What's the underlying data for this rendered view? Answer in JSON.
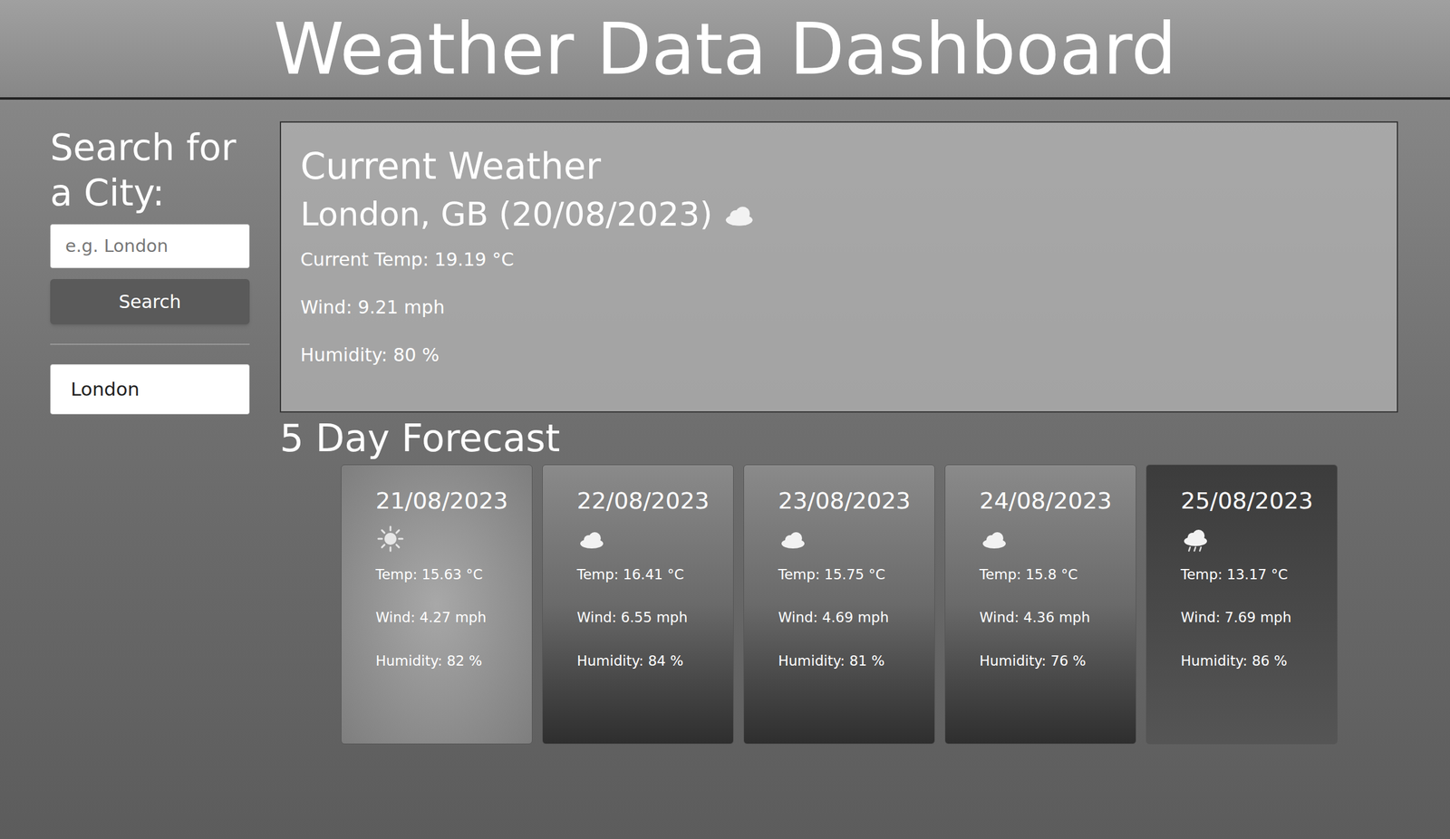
{
  "header": {
    "title": "Weather Data Dashboard"
  },
  "search": {
    "heading": "Search for a City:",
    "placeholder": "e.g. London",
    "button": "Search"
  },
  "history": [
    "London"
  ],
  "current": {
    "heading": "Current Weather",
    "location": "London, GB (20/08/2023)",
    "kind": "clouds",
    "temp": "Current Temp: 19.19 °C",
    "wind": "Wind: 9.21 mph",
    "humidity": "Humidity: 80 %"
  },
  "forecast": {
    "heading": "5 Day Forecast",
    "days": [
      {
        "date": "21/08/2023",
        "kind": "clear",
        "temp": "Temp: 15.63 °C",
        "wind": "Wind: 4.27 mph",
        "humidity": "Humidity: 82 %"
      },
      {
        "date": "22/08/2023",
        "kind": "clouds",
        "temp": "Temp: 16.41 °C",
        "wind": "Wind: 6.55 mph",
        "humidity": "Humidity: 84 %"
      },
      {
        "date": "23/08/2023",
        "kind": "clouds",
        "temp": "Temp: 15.75 °C",
        "wind": "Wind: 4.69 mph",
        "humidity": "Humidity: 81 %"
      },
      {
        "date": "24/08/2023",
        "kind": "clouds",
        "temp": "Temp: 15.8 °C",
        "wind": "Wind: 4.36 mph",
        "humidity": "Humidity: 76 %"
      },
      {
        "date": "25/08/2023",
        "kind": "rain",
        "temp": "Temp: 13.17 °C",
        "wind": "Wind: 7.69 mph",
        "humidity": "Humidity: 86 %"
      }
    ]
  }
}
